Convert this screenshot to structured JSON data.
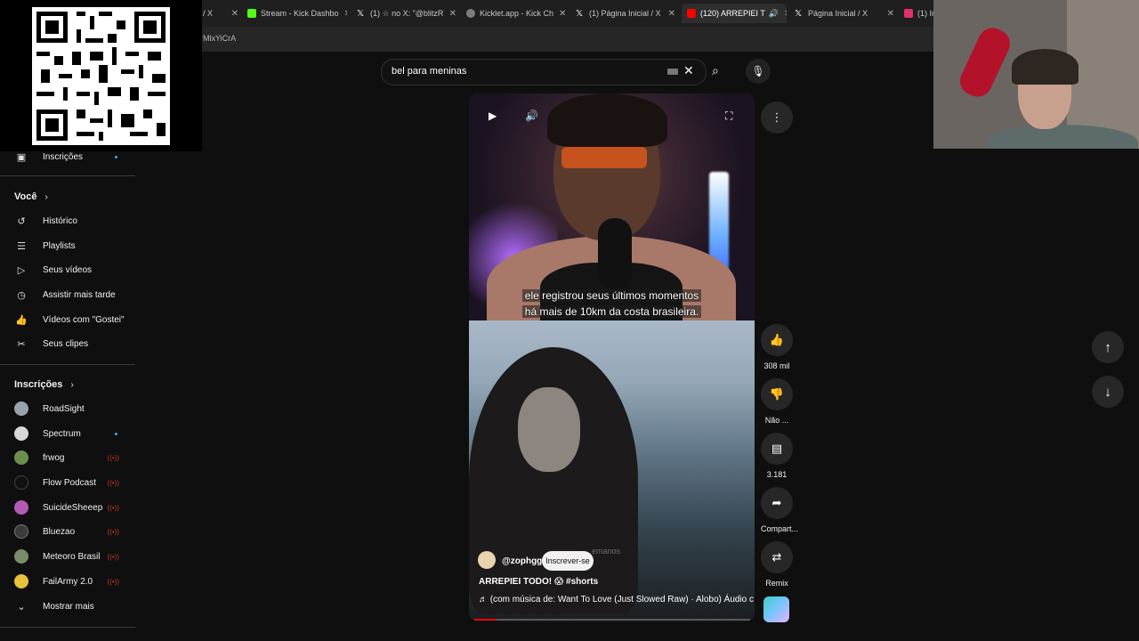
{
  "browser": {
    "tabs": [
      {
        "title": "/ X",
        "favicon_color": "#1f1f1f"
      },
      {
        "title": "Stream - Kick Dashbo",
        "favicon_color": "#53fc18"
      },
      {
        "title": "(1) ☆ no X: \"@blitzR",
        "favicon_color": "#ffffff"
      },
      {
        "title": "Kicklet.app - Kick Ch",
        "favicon_color": "#7d7d7d"
      },
      {
        "title": "(1) Página Inicial / X",
        "favicon_color": "#ffffff"
      },
      {
        "title": "(120) ARREPIEI T",
        "favicon_color": "#ff0000",
        "active": true
      },
      {
        "title": "Página Inicial / X",
        "favicon_color": "#ffffff"
      },
      {
        "title": "(1) In",
        "favicon_color": "#e1306c"
      }
    ],
    "url": "MlxYiCrA"
  },
  "sidebar": {
    "top_item": {
      "label": "Inscrições",
      "icon": "subscriptions-icon"
    },
    "you_header": "Você",
    "you_items": [
      {
        "label": "Histórico",
        "icon": "history-icon"
      },
      {
        "label": "Playlists",
        "icon": "playlists-icon"
      },
      {
        "label": "Seus vídeos",
        "icon": "your-videos-icon"
      },
      {
        "label": "Assistir mais tarde",
        "icon": "watch-later-icon"
      },
      {
        "label": "Vídeos com \"Gostei\"",
        "icon": "liked-icon"
      },
      {
        "label": "Seus clipes",
        "icon": "clips-icon"
      }
    ],
    "subs_header": "Inscrições",
    "subs": [
      {
        "label": "RoadSight",
        "avatar_color": "#9aa3ab",
        "status": ""
      },
      {
        "label": "Spectrum",
        "avatar_color": "#d8d8d8",
        "status": "new"
      },
      {
        "label": "frwog",
        "avatar_color": "#6b8e4e",
        "status": "live"
      },
      {
        "label": "Flow Podcast",
        "avatar_color": "#111111",
        "status": "live"
      },
      {
        "label": "SuicideSheeep",
        "avatar_color": "#b15bb5",
        "status": "live"
      },
      {
        "label": "Bluezao",
        "avatar_color": "#3b3b3b",
        "status": "live"
      },
      {
        "label": "Meteoro Brasil",
        "avatar_color": "#7a8a6a",
        "status": "live"
      },
      {
        "label": "FailArmy 2.0",
        "avatar_color": "#e5c23a",
        "status": "live"
      }
    ],
    "show_more": "Mostrar mais"
  },
  "search": {
    "query": "bel para meninas"
  },
  "video": {
    "caption_line1": "ele registrou seus últimos momentos",
    "caption_line2": "há mais de 10km da costa brasileira.",
    "channel": "@zophgg",
    "subscribe": "Inscrever-se",
    "title": "ARREPIEI TODO! 😱",
    "hashtag": "#shorts",
    "music": "♬  (com música de: Want To Love (Just Slowed Raw) · Alobo)  Áudio c",
    "watermark": "emanos",
    "progress_fraction": 0.08
  },
  "actions": {
    "likes": "308 mil",
    "dislike": "Não ...",
    "comments": "3.181",
    "share": "Compart...",
    "remix": "Remix"
  }
}
